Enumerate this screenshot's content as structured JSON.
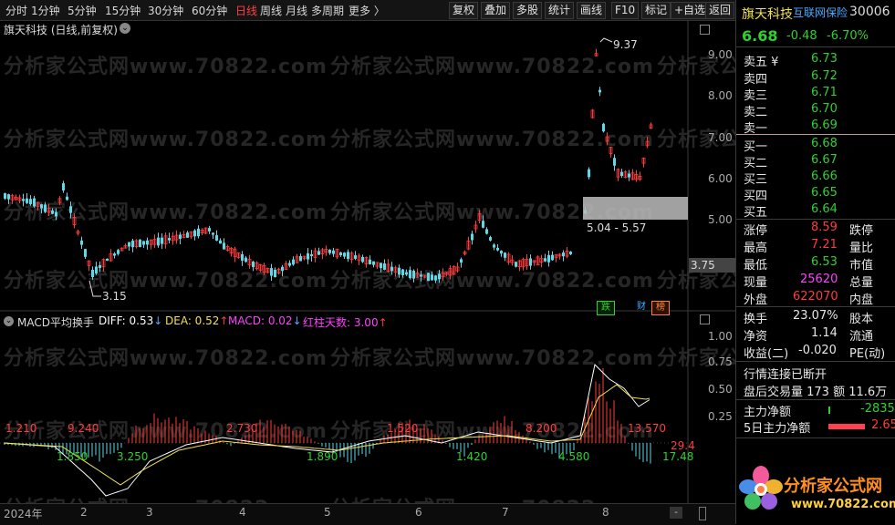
{
  "toolbar": {
    "items": [
      "分时",
      "1分钟",
      "5分钟",
      "15分钟",
      "30分钟",
      "60分钟",
      "日线",
      "周线",
      "月线",
      "多周期",
      "更多 〉"
    ],
    "active_item": "日线",
    "buttons": [
      "复权",
      "叠加",
      "多股",
      "统计",
      "画线",
      "F10",
      "标记",
      "+自选",
      "返回"
    ]
  },
  "chart": {
    "title": "旗天科技 (日线,前复权)",
    "watermark": "分析家公式网www.70822.com",
    "price_axis": [
      "9.00",
      "8.00",
      "7.00",
      "6.00",
      "5.00"
    ],
    "current_price_tag": "3.75",
    "high_label": "9.37",
    "low_label": "3.15",
    "range_label": "5.04 - 5.57",
    "event_tags": [
      {
        "text": "跌",
        "color": "#2fd02f"
      },
      {
        "text": "财",
        "color": "#4aa8ff"
      },
      {
        "text": "榜",
        "color": "#ff8040"
      }
    ]
  },
  "macd": {
    "name": "MACD平均换手",
    "diff_label": "DIFF: 0.53",
    "dea_label": "DEA: 0.52",
    "macd_label": "MACD: 0.02",
    "red_days_label": "红柱天数: 3.00",
    "axis": [
      "1.00",
      "0.75",
      "0.50",
      "0.25"
    ],
    "red_values": [
      "1.210",
      "9.240",
      "2.730",
      "1.520",
      "8.200",
      "13.570",
      "29.4"
    ],
    "green_values": [
      "1.850",
      "3.250",
      "1.890",
      "1.420",
      "4.580",
      "17.48"
    ]
  },
  "xaxis": {
    "labels": [
      "2024年",
      "2",
      "3",
      "4",
      "5",
      "6",
      "7",
      "8"
    ]
  },
  "colors": {
    "up": "#ff3b3b",
    "down": "#5fd8e8",
    "diff": "#ffffff",
    "dea": "#f0e050",
    "accent": "#ff3b3b"
  },
  "quote": {
    "name": "旗天科技",
    "tag": "互联网保险",
    "code": "30006",
    "price": "6.68",
    "change": "-0.48",
    "change_pct": "-6.70%",
    "asks": [
      {
        "label": "卖五 ¥",
        "price": "6.73"
      },
      {
        "label": "卖四",
        "price": "6.72"
      },
      {
        "label": "卖三",
        "price": "6.71"
      },
      {
        "label": "卖二",
        "price": "6.70"
      },
      {
        "label": "卖一",
        "price": "6.69"
      }
    ],
    "bids": [
      {
        "label": "买一",
        "price": "6.68"
      },
      {
        "label": "买二",
        "price": "6.67"
      },
      {
        "label": "买三",
        "price": "6.66"
      },
      {
        "label": "买四",
        "price": "6.65"
      },
      {
        "label": "买五",
        "price": "6.64"
      }
    ],
    "stats": {
      "limit_up_label": "涨停",
      "limit_up": "8.59",
      "limit_down_label": "跌停",
      "high_label": "最高",
      "high": "7.21",
      "vol_ratio_label": "量比",
      "low_label": "最低",
      "low": "6.53",
      "mkt_cap_label": "市值",
      "now_label": "现量",
      "now": "25620",
      "total_label": "总量",
      "outer_label": "外盘",
      "outer": "622070",
      "inner_label": "内盘",
      "turnover_label": "换手",
      "turnover": "23.07%",
      "equity_label": "股本",
      "nav_label": "净资",
      "nav": "1.14",
      "float_label": "流通",
      "eps_label": "收益(二)",
      "eps": "-0.020",
      "pe_label": "PE(动)"
    },
    "status": "行情连接已断开",
    "after_hours": "盘后交易量 173 额 11.6万",
    "net_flow_label": "主力净额",
    "net_flow": "-2835",
    "net_flow5_label": "5日主力净额",
    "net_flow5": "2.65"
  },
  "logo": {
    "text": "分析家公式网",
    "url_text": "www.70822.com"
  }
}
